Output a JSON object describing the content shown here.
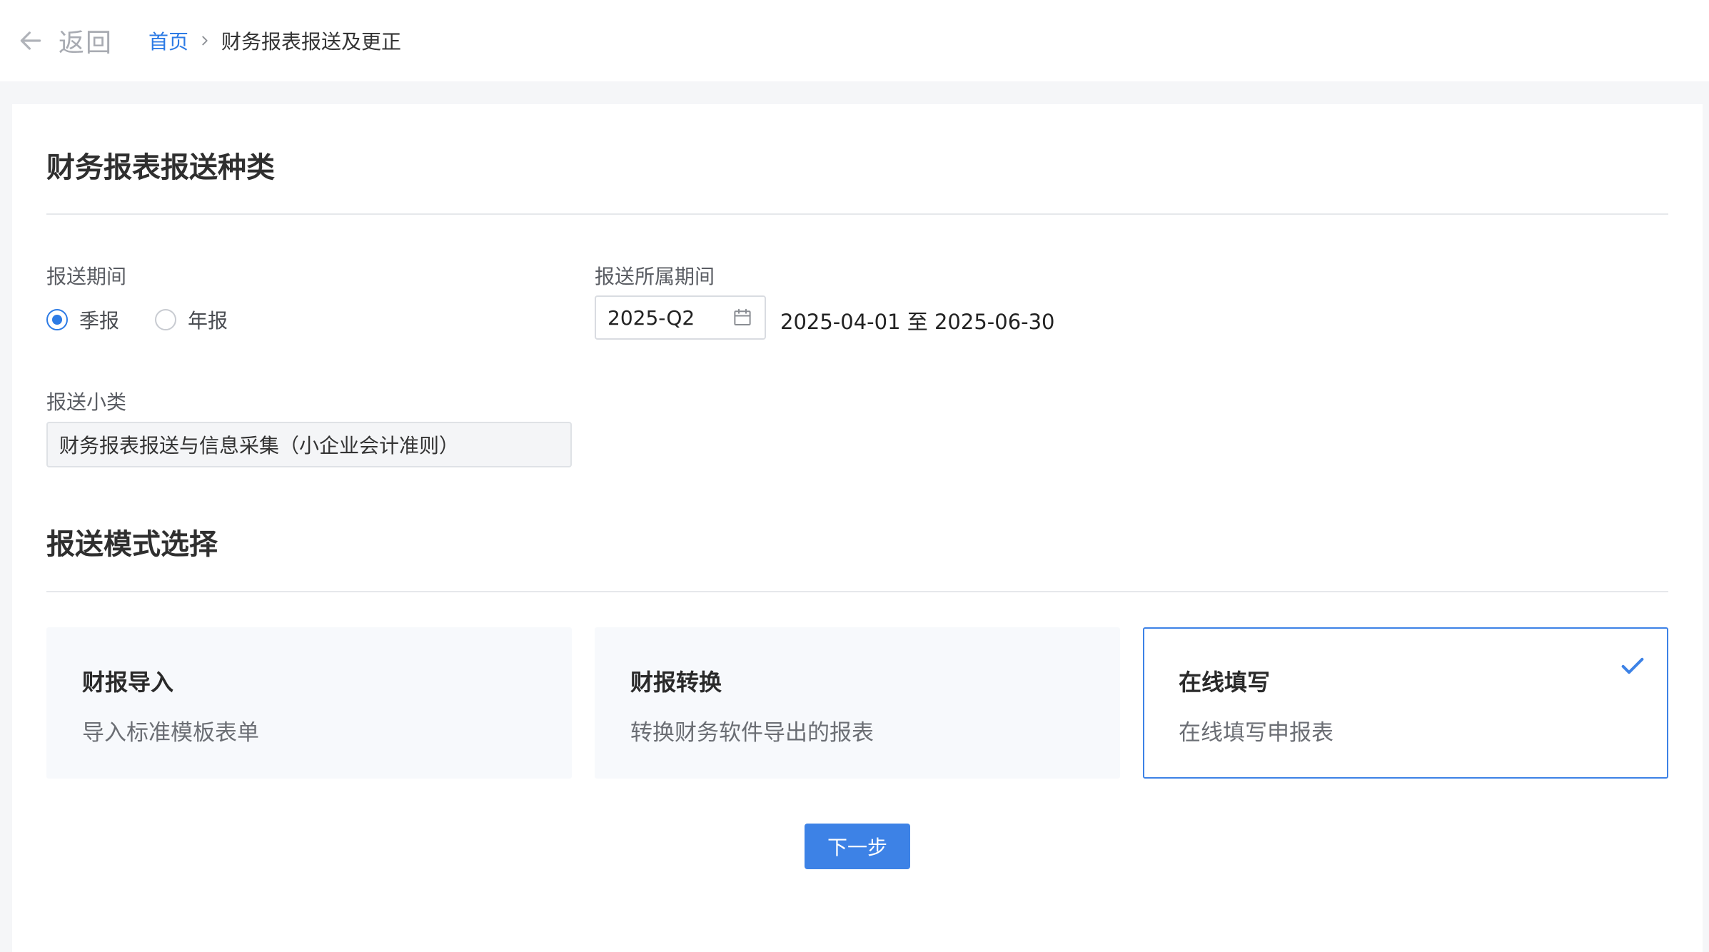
{
  "header": {
    "back_label": "返回",
    "breadcrumb": {
      "home": "首页",
      "current": "财务报表报送及更正"
    }
  },
  "section_type": {
    "title": "财务报表报送种类",
    "period": {
      "label": "报送期间",
      "options": [
        {
          "label": "季报",
          "selected": true
        },
        {
          "label": "年报",
          "selected": false
        }
      ]
    },
    "belong_period": {
      "label": "报送所属期间",
      "value": "2025-Q2",
      "range": "2025-04-01 至 2025-06-30"
    },
    "subcategory": {
      "label": "报送小类",
      "value": "财务报表报送与信息采集（小企业会计准则）"
    }
  },
  "section_mode": {
    "title": "报送模式选择",
    "modes": [
      {
        "title": "财报导入",
        "desc": "导入标准模板表单",
        "selected": false
      },
      {
        "title": "财报转换",
        "desc": "转换财务软件导出的报表",
        "selected": false
      },
      {
        "title": "在线填写",
        "desc": "在线填写申报表",
        "selected": true
      }
    ]
  },
  "actions": {
    "next_label": "下一步"
  },
  "colors": {
    "accent": "#3d82e6",
    "link": "#2d7be5",
    "background": "#f5f6f8"
  }
}
